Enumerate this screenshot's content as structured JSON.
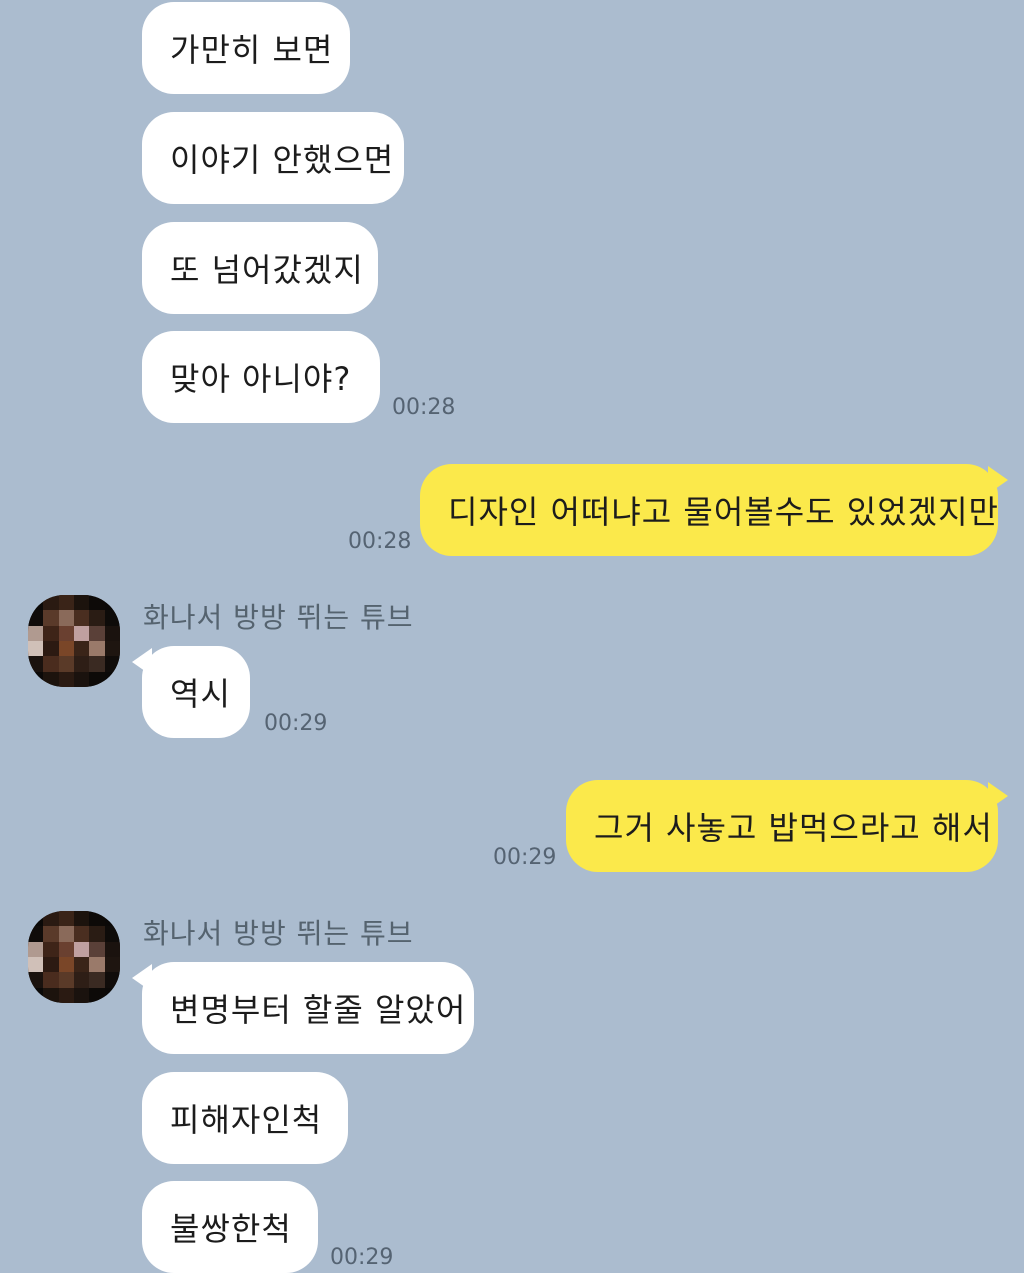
{
  "messages": [
    {
      "text": "가만히 보면"
    },
    {
      "text": "이야기 안했으면"
    },
    {
      "text": "또 넘어갔겠지"
    },
    {
      "text": "맞아 아니야?",
      "time": "00:28"
    },
    {
      "text": "디자인 어떠냐고 물어볼수도 있었겠지만",
      "time": "00:28"
    },
    {
      "sender": "화나서 방방 뛰는 튜브",
      "text": "역시",
      "time": "00:29"
    },
    {
      "text": "그거 사놓고 밥먹으라고 해서",
      "time": "00:29"
    },
    {
      "sender": "화나서 방방 뛰는 튜브",
      "text": "변명부터 할줄 알았어"
    },
    {
      "text": "피해자인척"
    },
    {
      "text": "불쌍한척",
      "time": "00:29"
    }
  ],
  "colors": {
    "background": "#abbccf",
    "incoming_bubble": "#ffffff",
    "outgoing_bubble": "#fbe94b"
  },
  "avatar_icon": "blurred-profile-photo"
}
